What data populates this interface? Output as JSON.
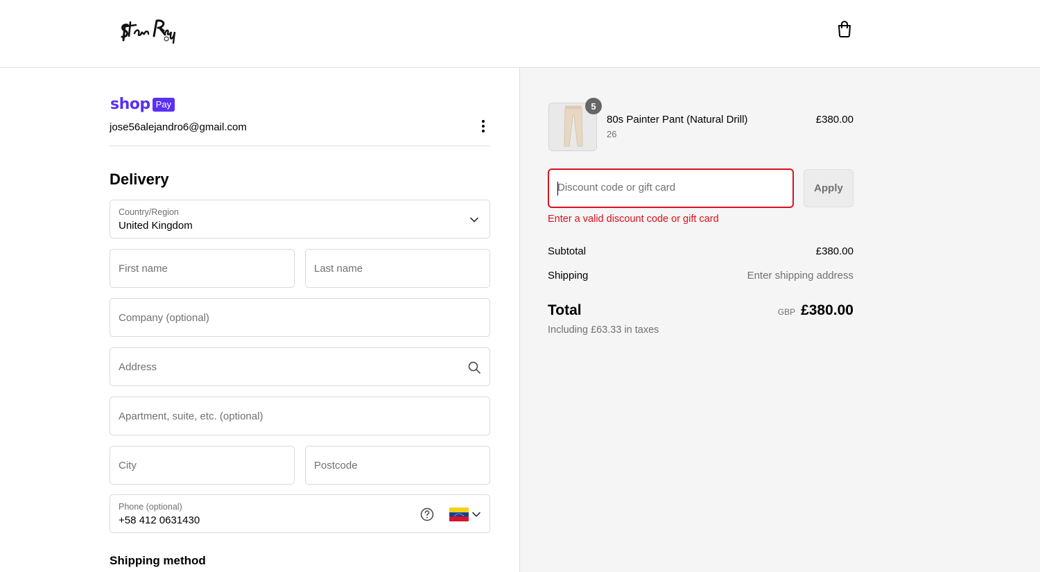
{
  "header": {
    "logo_text": "StanRay",
    "cart_icon": "shopping-bag-icon"
  },
  "account": {
    "shop_word": "shop",
    "pay_badge": "Pay",
    "email": "jose56alejandro6@gmail.com",
    "menu_icon": "more-vertical-icon"
  },
  "delivery": {
    "heading": "Delivery",
    "country_label": "Country/Region",
    "country_value": "United Kingdom",
    "first_name_placeholder": "First name",
    "last_name_placeholder": "Last name",
    "company_placeholder": "Company (optional)",
    "address_placeholder": "Address",
    "apartment_placeholder": "Apartment, suite, etc. (optional)",
    "city_placeholder": "City",
    "postcode_placeholder": "Postcode",
    "phone_label": "Phone (optional)",
    "phone_value": "+58 412 0631430",
    "phone_flag": "venezuela-flag-icon"
  },
  "shipping_method": {
    "heading": "Shipping method"
  },
  "order_summary": {
    "item": {
      "name": "80s Painter Pant (Natural Drill)",
      "variant": "26",
      "price": "£380.00",
      "quantity": "5"
    },
    "discount": {
      "placeholder": "Discount code or gift card",
      "apply_label": "Apply",
      "error": "Enter a valid discount code or gift card"
    },
    "subtotal_label": "Subtotal",
    "subtotal_value": "£380.00",
    "shipping_label": "Shipping",
    "shipping_value": "Enter shipping address",
    "total_label": "Total",
    "currency": "GBP",
    "total_value": "£380.00",
    "taxes_note": "Including £63.33 in taxes"
  },
  "colors": {
    "shop_pay_purple": "#5a31f4",
    "error_red": "#d9101e",
    "summary_background": "#f5f5f5"
  }
}
